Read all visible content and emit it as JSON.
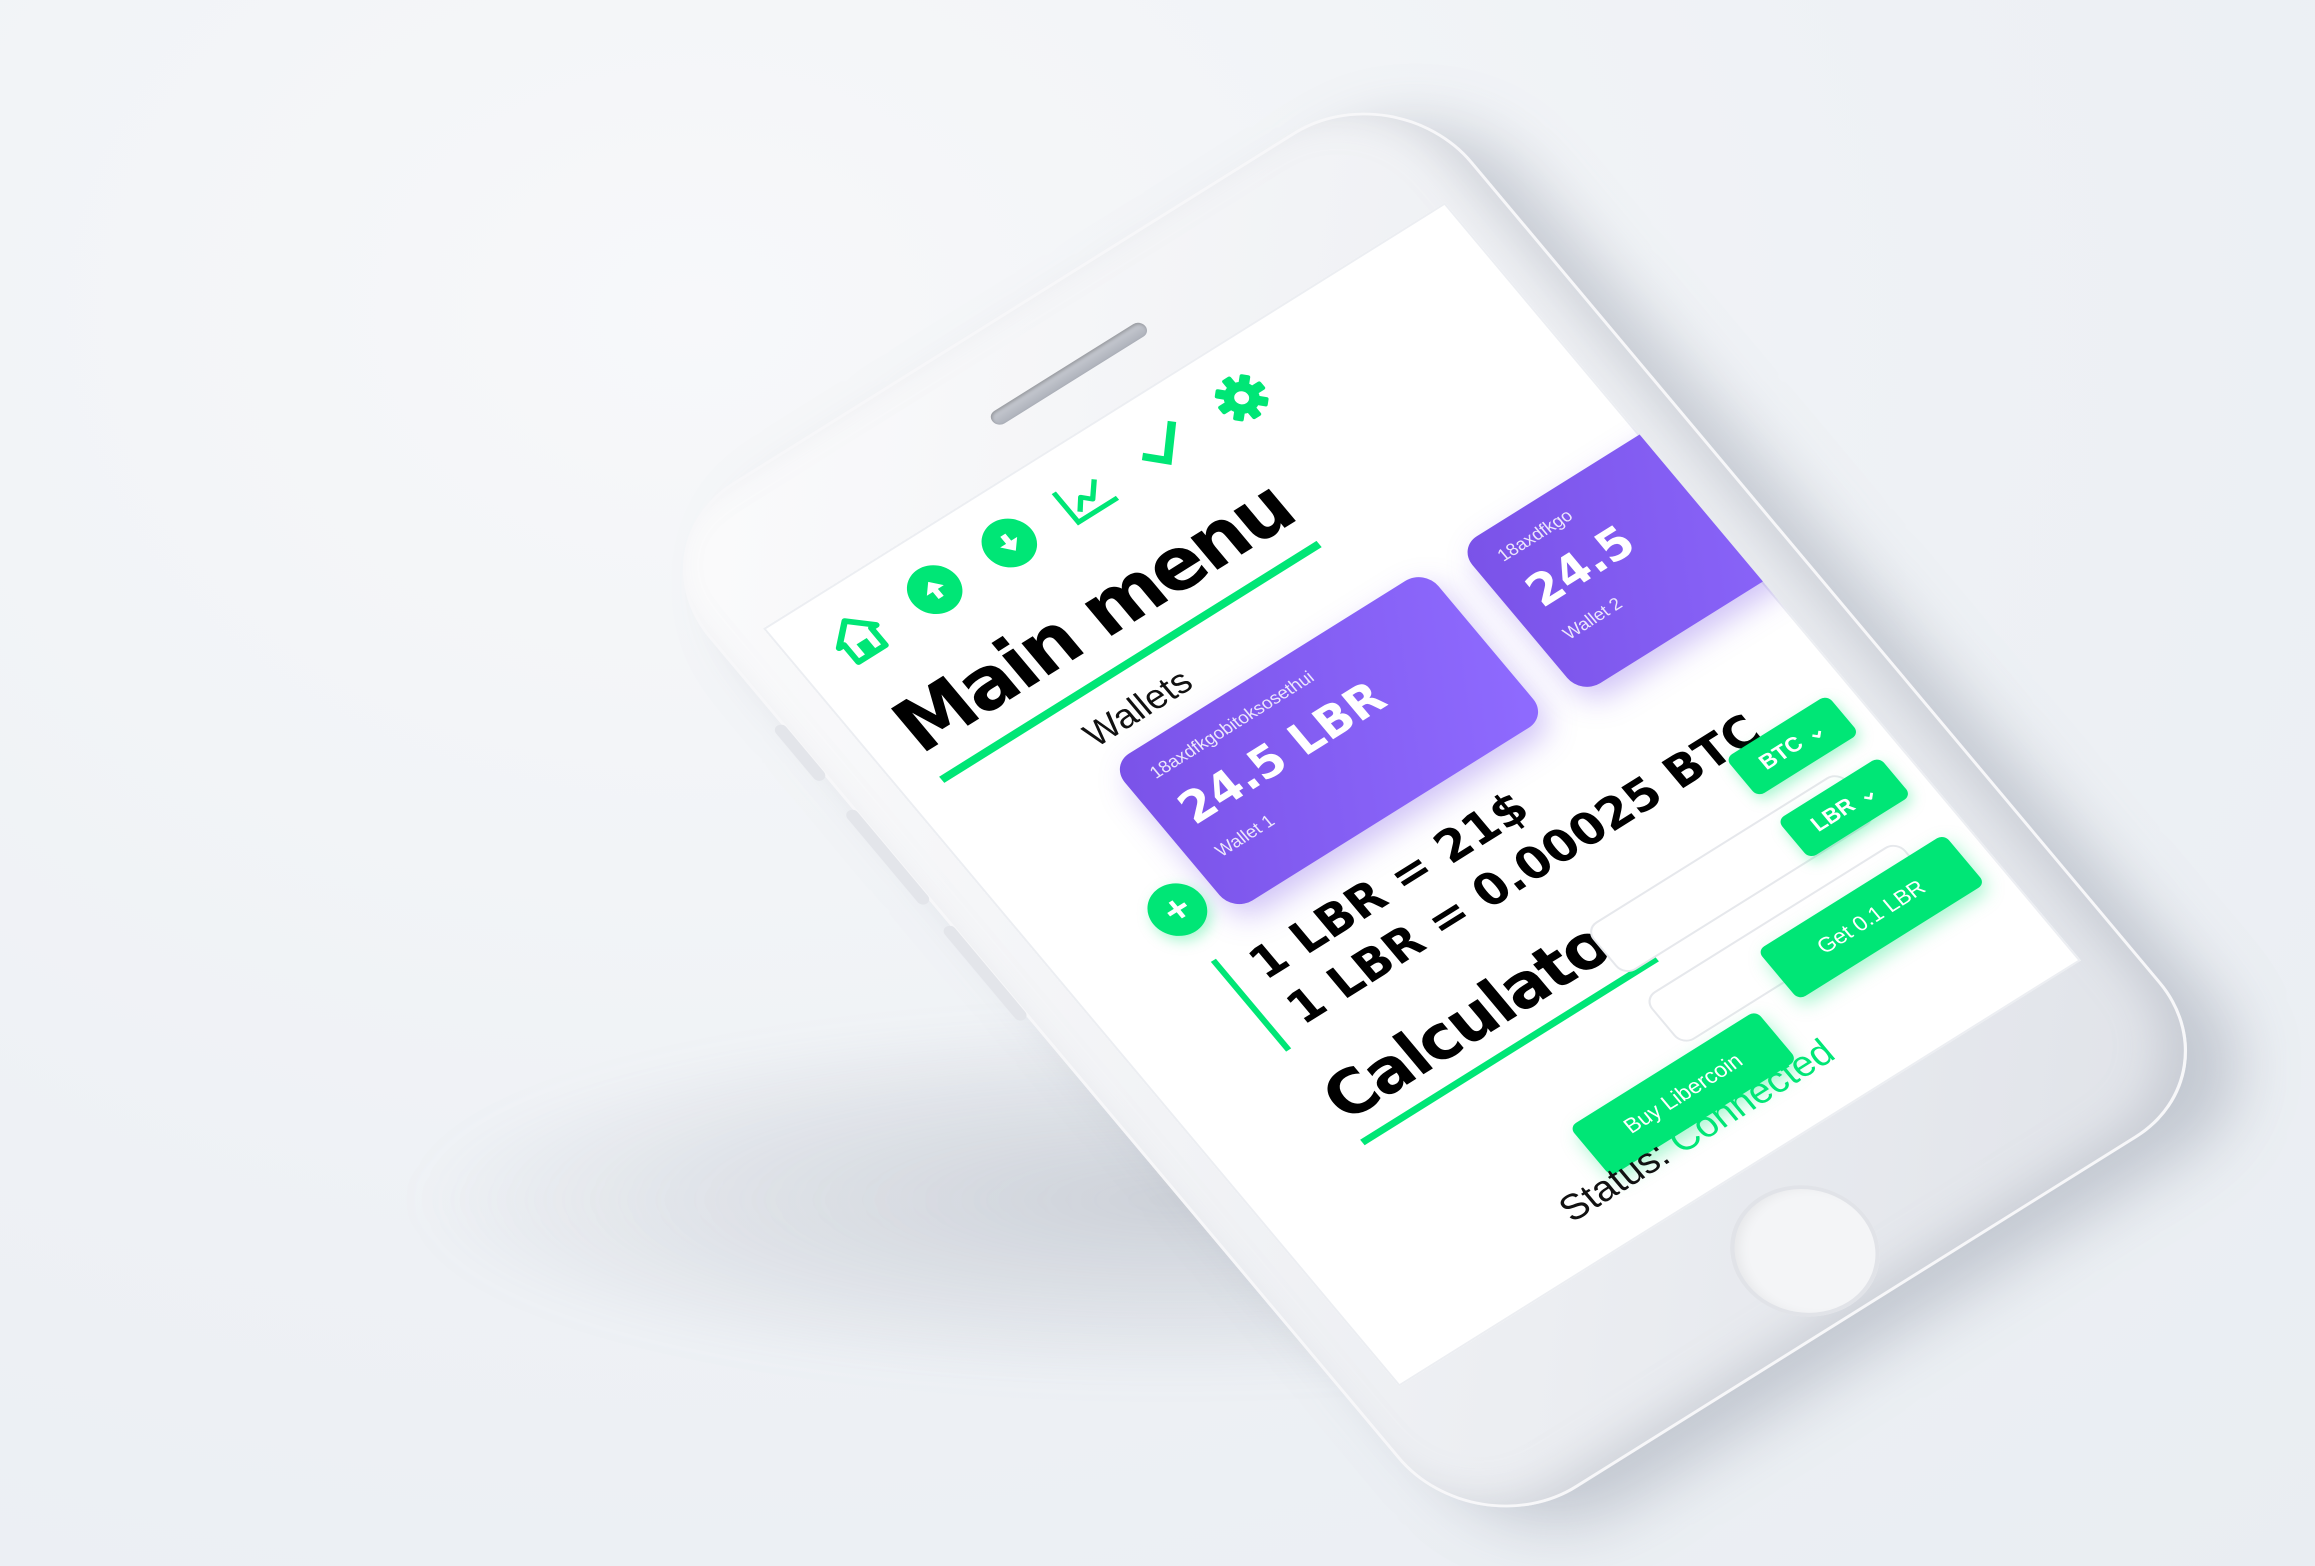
{
  "colors": {
    "accent": "#00e676",
    "wallet_card": "#7a52e8",
    "text": "#000000"
  },
  "nav": {
    "items": [
      {
        "icon": "home-icon"
      },
      {
        "icon": "send-up-icon"
      },
      {
        "icon": "receive-down-icon"
      },
      {
        "icon": "chart-icon"
      },
      {
        "icon": "check-icon"
      },
      {
        "icon": "gear-icon"
      }
    ]
  },
  "main": {
    "title": "Main menu",
    "wallets_label": "Wallets",
    "add_wallet_symbol": "+",
    "wallets": [
      {
        "address": "18axdfkgobitoksosethui",
        "amount": "24.5 LBR",
        "name": "Wallet 1"
      },
      {
        "address": "18axdfkgo",
        "amount": "24.5",
        "name": "Wallet 2"
      }
    ]
  },
  "rates": {
    "usd": "1 LBR = 21$",
    "btc": "1 LBR = 0.00025 BTC"
  },
  "calculator": {
    "title": "Calculator",
    "from_currency": "BTC",
    "to_currency": "LBR",
    "buy_label": "Buy Libercoin",
    "get_label": "Get 0.1 LBR"
  },
  "status": {
    "label": "Status:",
    "value": "Connected"
  }
}
